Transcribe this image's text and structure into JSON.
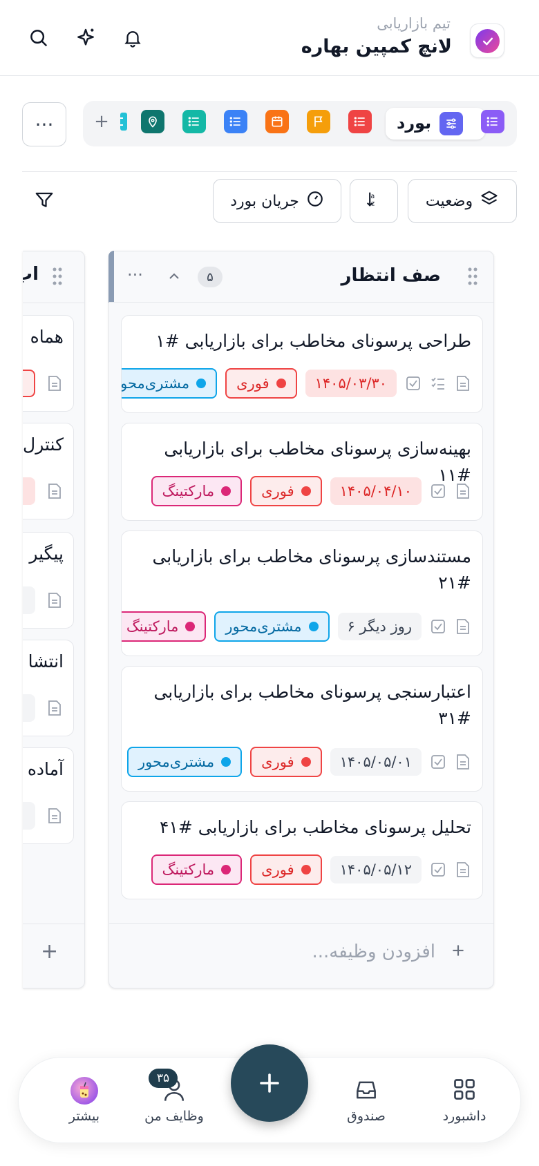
{
  "header": {
    "team": "تیم بازاریابی",
    "project": "لانچ کمپین بهاره"
  },
  "views": {
    "active_label": "بورد",
    "more": "···",
    "add": "+"
  },
  "filters": {
    "status": "وضعیت",
    "board_flow": "جریان بورد"
  },
  "column": {
    "title": "صف انتظار",
    "count": "۵",
    "add_task": "افزودن وظیفه...",
    "cards": [
      {
        "title": "طراحی پرسونای مخاطب برای بازاریابی #۱",
        "date": "۱۴۰۵/۰۳/۳۰",
        "tag1": "فوری",
        "tag2": "مشتری‌محور"
      },
      {
        "title": "بهینه‌سازی پرسونای مخاطب برای بازاریابی #۱۱",
        "date": "۱۴۰۵/۰۴/۱۰",
        "tag1": "فوری",
        "tag2": "مارکتینگ"
      },
      {
        "title": "مستندسازی پرسونای مخاطب برای بازاریابی #۲۱",
        "date": "۶ روز دیگر",
        "tag1": "مشتری‌محور",
        "tag2": "مارکتینگ"
      },
      {
        "title": "اعتبارسنجی پرسونای مخاطب برای بازاریابی #۳۱",
        "date": "۱۴۰۵/۰۵/۰۱",
        "tag1": "فوری",
        "tag2": "مشتری‌محور"
      },
      {
        "title": "تحلیل پرسونای مخاطب برای بازاریابی #۴۱",
        "date": "۱۴۰۵/۰۵/۱۲",
        "tag1": "فوری",
        "tag2": "مارکتینگ"
      }
    ]
  },
  "column2": {
    "title": "اب",
    "cards": [
      "هماه",
      "کنترل",
      "پیگیر",
      "انتشا",
      "آماده"
    ],
    "add": "+"
  },
  "nav": {
    "dashboard": "داشبورد",
    "inbox": "صندوق",
    "my_tasks": "وظایف من",
    "my_tasks_badge": "۳۵",
    "more": "بیشتر"
  },
  "colors": {
    "fab": "#27495a",
    "urgent": "#ef4444",
    "marketing": "#db2777",
    "customer": "#0ea5e9"
  }
}
